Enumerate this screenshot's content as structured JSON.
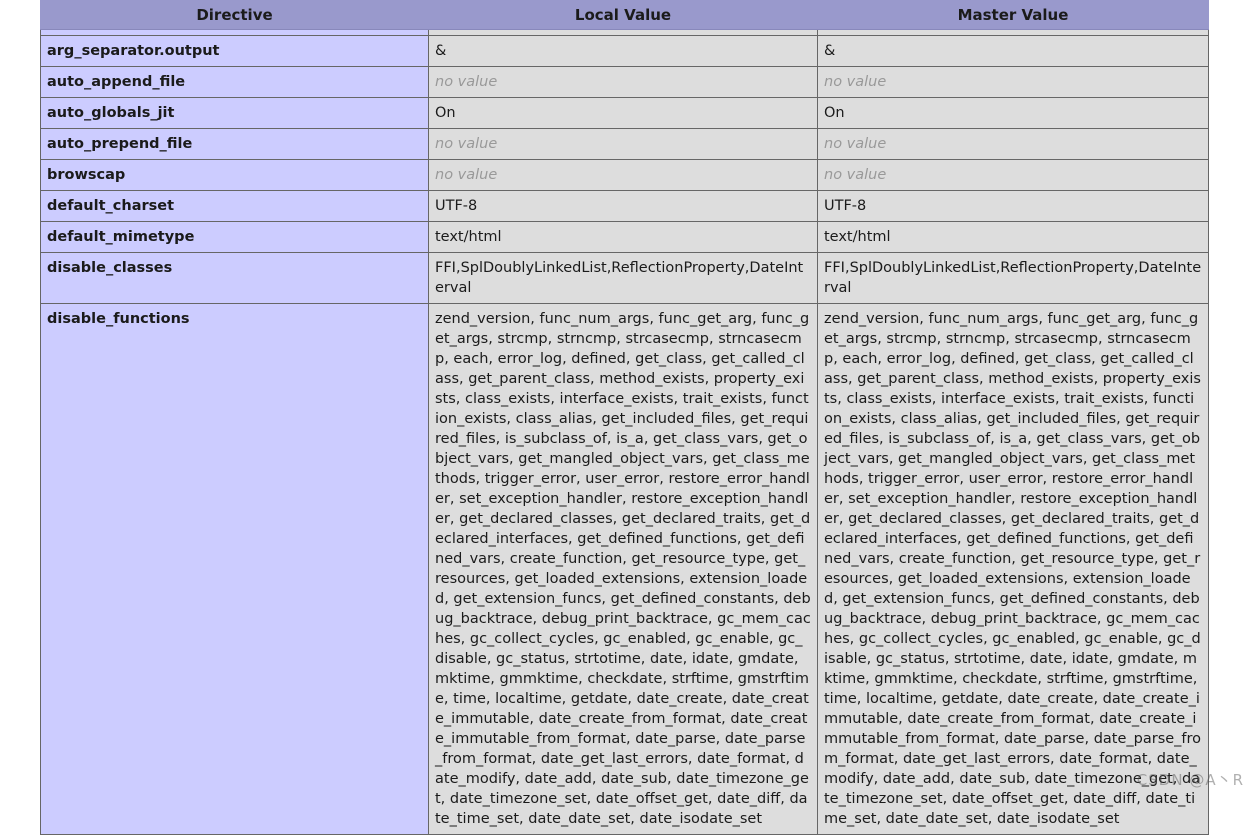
{
  "header": {
    "directive": "Directive",
    "local": "Local Value",
    "master": "Master Value"
  },
  "rows": [
    {
      "name": "arg_separator.output",
      "local": "&",
      "master": "&",
      "novalue": false
    },
    {
      "name": "auto_append_file",
      "local": "no value",
      "master": "no value",
      "novalue": true
    },
    {
      "name": "auto_globals_jit",
      "local": "On",
      "master": "On",
      "novalue": false
    },
    {
      "name": "auto_prepend_file",
      "local": "no value",
      "master": "no value",
      "novalue": true
    },
    {
      "name": "browscap",
      "local": "no value",
      "master": "no value",
      "novalue": true
    },
    {
      "name": "default_charset",
      "local": "UTF-8",
      "master": "UTF-8",
      "novalue": false
    },
    {
      "name": "default_mimetype",
      "local": "text/html",
      "master": "text/html",
      "novalue": false
    },
    {
      "name": "disable_classes",
      "local": "FFI,SplDoublyLinkedList,ReflectionProperty,DateInterval",
      "master": "FFI,SplDoublyLinkedList,ReflectionProperty,DateInterval",
      "novalue": false
    },
    {
      "name": "disable_functions",
      "local": "zend_version, func_num_args, func_get_arg, func_get_args, strcmp, strncmp, strcasecmp, strncasecmp, each, error_log, defined, get_class, get_called_class, get_parent_class, method_exists, property_exists, class_exists, interface_exists, trait_exists, function_exists, class_alias, get_included_files, get_required_files, is_subclass_of, is_a, get_class_vars, get_object_vars, get_mangled_object_vars, get_class_methods, trigger_error, user_error, restore_error_handler, set_exception_handler, restore_exception_handler, get_declared_classes, get_declared_traits, get_declared_interfaces, get_defined_functions, get_defined_vars, create_function, get_resource_type, get_resources, get_loaded_extensions, extension_loaded, get_extension_funcs, get_defined_constants, debug_backtrace, debug_print_backtrace, gc_mem_caches, gc_collect_cycles, gc_enabled, gc_enable, gc_disable, gc_status, strtotime, date, idate, gmdate, mktime, gmmktime, checkdate, strftime, gmstrftime, time, localtime, getdate, date_create, date_create_immutable, date_create_from_format, date_create_immutable_from_format, date_parse, date_parse_from_format, date_get_last_errors, date_format, date_modify, date_add, date_sub, date_timezone_get, date_timezone_set, date_offset_get, date_diff, date_time_set, date_date_set, date_isodate_set",
      "master": "zend_version, func_num_args, func_get_arg, func_get_args, strcmp, strncmp, strcasecmp, strncasecmp, each, error_log, defined, get_class, get_called_class, get_parent_class, method_exists, property_exists, class_exists, interface_exists, trait_exists, function_exists, class_alias, get_included_files, get_required_files, is_subclass_of, is_a, get_class_vars, get_object_vars, get_mangled_object_vars, get_class_methods, trigger_error, user_error, restore_error_handler, set_exception_handler, restore_exception_handler, get_declared_classes, get_declared_traits, get_declared_interfaces, get_defined_functions, get_defined_vars, create_function, get_resource_type, get_resources, get_loaded_extensions, extension_loaded, get_extension_funcs, get_defined_constants, debug_backtrace, debug_print_backtrace, gc_mem_caches, gc_collect_cycles, gc_enabled, gc_enable, gc_disable, gc_status, strtotime, date, idate, gmdate, mktime, gmmktime, checkdate, strftime, gmstrftime, time, localtime, getdate, date_create, date_create_immutable, date_create_from_format, date_create_immutable_from_format, date_parse, date_parse_from_format, date_get_last_errors, date_format, date_modify, date_add, date_sub, date_timezone_get, date_timezone_set, date_offset_get, date_diff, date_time_set, date_date_set, date_isodate_set",
      "novalue": false
    }
  ],
  "watermark": "CSDN @A丶R",
  "colors": {
    "header_bg": "#9999cc",
    "directive_bg": "#ccccff",
    "value_bg": "#dddddd",
    "novalue_text": "#999999"
  }
}
